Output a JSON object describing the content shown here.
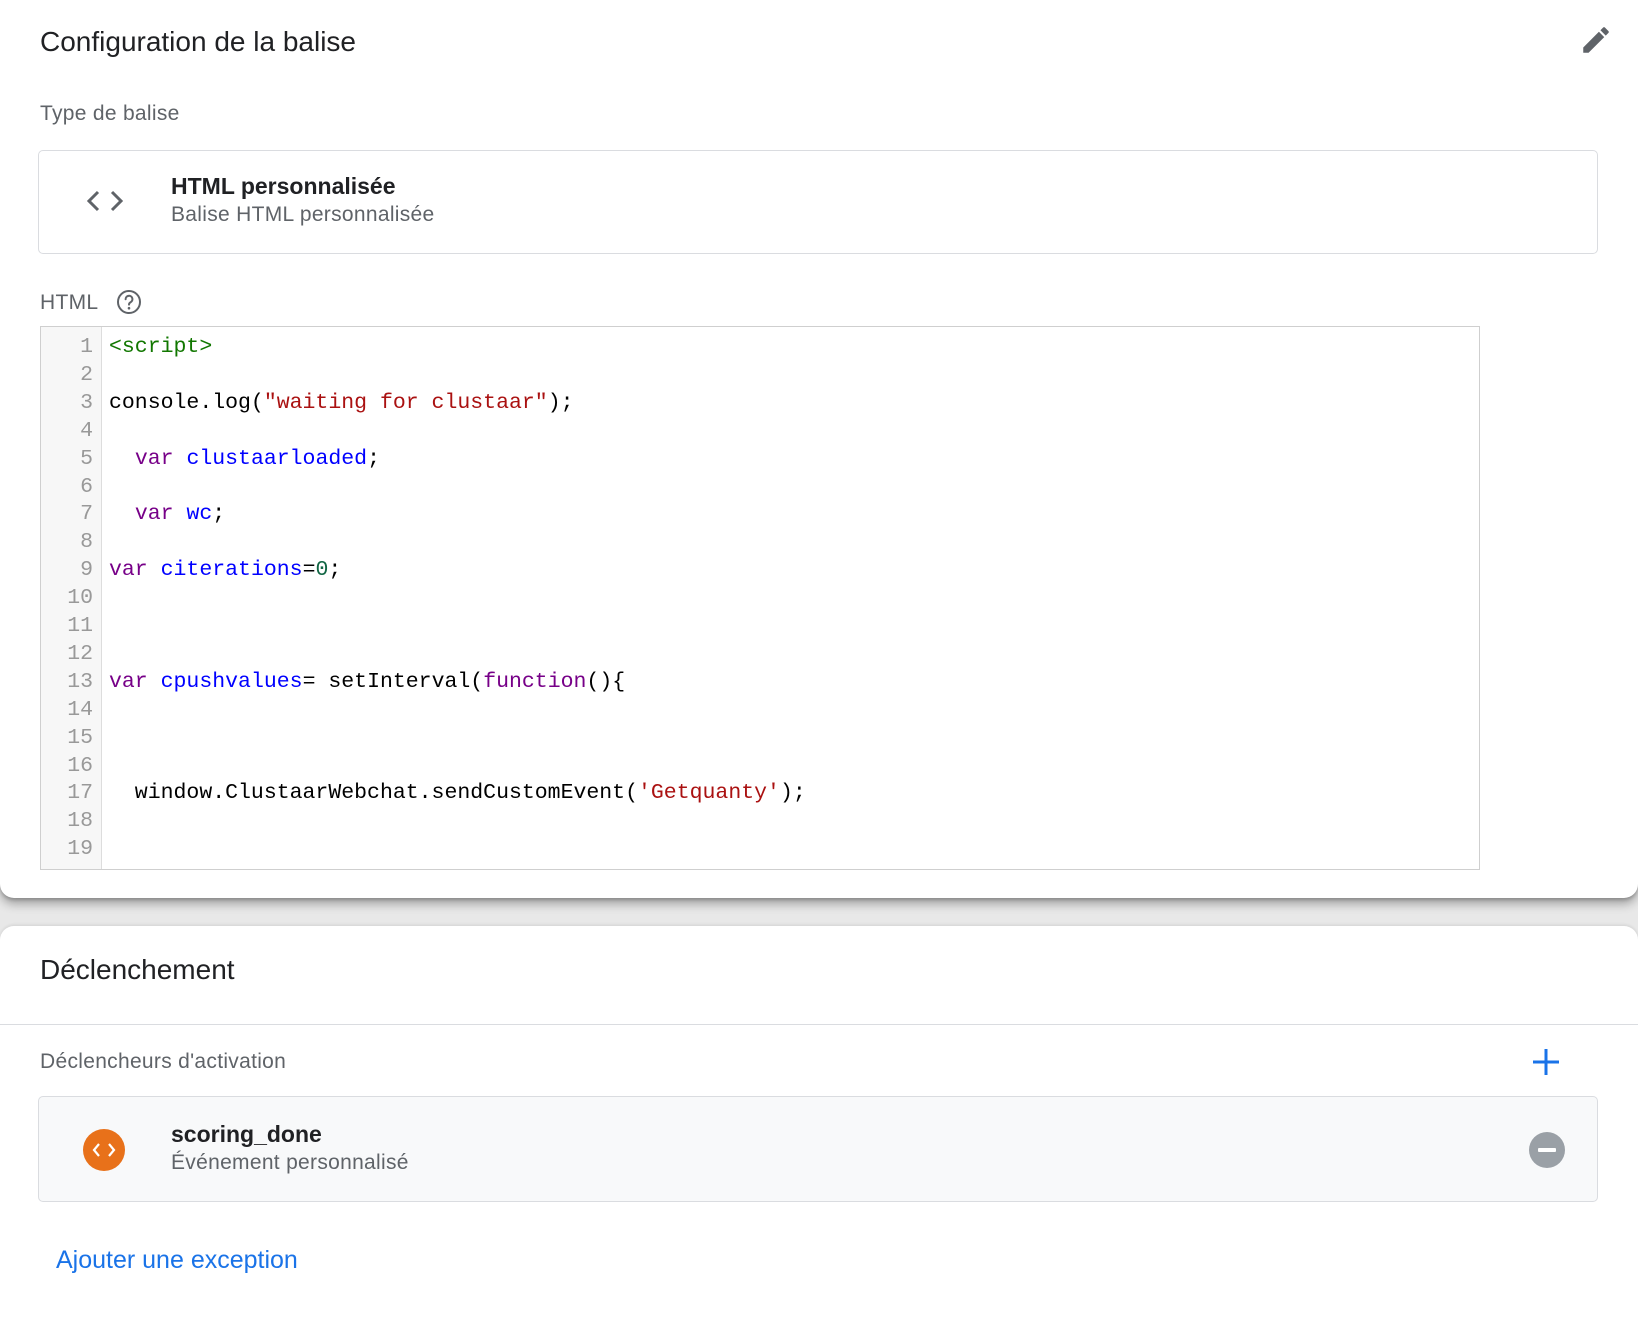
{
  "config": {
    "title": "Configuration de la balise",
    "type_label": "Type de balise",
    "tag_type": {
      "icon": "code-brackets-icon",
      "title": "HTML personnalisée",
      "subtitle": "Balise HTML personnalisée"
    },
    "html_label": "HTML",
    "code_lines": [
      {
        "n": "1",
        "parts": [
          {
            "t": "<script>",
            "c": "tag"
          }
        ]
      },
      {
        "n": "2",
        "parts": []
      },
      {
        "n": "3",
        "parts": [
          {
            "t": "console.log(",
            "c": ""
          },
          {
            "t": "\"waiting for clustaar\"",
            "c": "str"
          },
          {
            "t": ");",
            "c": ""
          }
        ]
      },
      {
        "n": "4",
        "parts": []
      },
      {
        "n": "5",
        "parts": [
          {
            "t": "  ",
            "c": ""
          },
          {
            "t": "var",
            "c": "kw"
          },
          {
            "t": " ",
            "c": ""
          },
          {
            "t": "clustaarloaded",
            "c": "def"
          },
          {
            "t": ";",
            "c": ""
          }
        ]
      },
      {
        "n": "6",
        "parts": []
      },
      {
        "n": "7",
        "parts": [
          {
            "t": "  ",
            "c": ""
          },
          {
            "t": "var",
            "c": "kw"
          },
          {
            "t": " ",
            "c": ""
          },
          {
            "t": "wc",
            "c": "def"
          },
          {
            "t": ";",
            "c": ""
          }
        ]
      },
      {
        "n": "8",
        "parts": []
      },
      {
        "n": "9",
        "parts": [
          {
            "t": "var",
            "c": "kw"
          },
          {
            "t": " ",
            "c": ""
          },
          {
            "t": "citerations",
            "c": "def"
          },
          {
            "t": "=",
            "c": ""
          },
          {
            "t": "0",
            "c": "num"
          },
          {
            "t": ";",
            "c": ""
          }
        ]
      },
      {
        "n": "10",
        "parts": []
      },
      {
        "n": "11",
        "parts": []
      },
      {
        "n": "12",
        "parts": []
      },
      {
        "n": "13",
        "parts": [
          {
            "t": "var",
            "c": "kw"
          },
          {
            "t": " ",
            "c": ""
          },
          {
            "t": "cpushvalues",
            "c": "def"
          },
          {
            "t": "= setInterval(",
            "c": ""
          },
          {
            "t": "function",
            "c": "kw"
          },
          {
            "t": "(){",
            "c": ""
          }
        ]
      },
      {
        "n": "14",
        "parts": []
      },
      {
        "n": "15",
        "parts": []
      },
      {
        "n": "16",
        "parts": []
      },
      {
        "n": "17",
        "parts": [
          {
            "t": "  window.ClustaarWebchat.sendCustomEvent(",
            "c": ""
          },
          {
            "t": "'Getquanty'",
            "c": "str"
          },
          {
            "t": ");",
            "c": ""
          }
        ]
      },
      {
        "n": "18",
        "parts": []
      },
      {
        "n": "19",
        "parts": []
      }
    ]
  },
  "triggering": {
    "title": "Déclenchement",
    "firing_label": "Déclencheurs d'activation",
    "triggers": [
      {
        "name": "scoring_done",
        "type": "Événement personnalisé",
        "icon": "code-brackets-icon",
        "icon_color": "#e8711a"
      }
    ],
    "add_exception": "Ajouter une exception"
  },
  "colors": {
    "accent": "#1a73e8",
    "trigger_orange": "#e8711a"
  }
}
